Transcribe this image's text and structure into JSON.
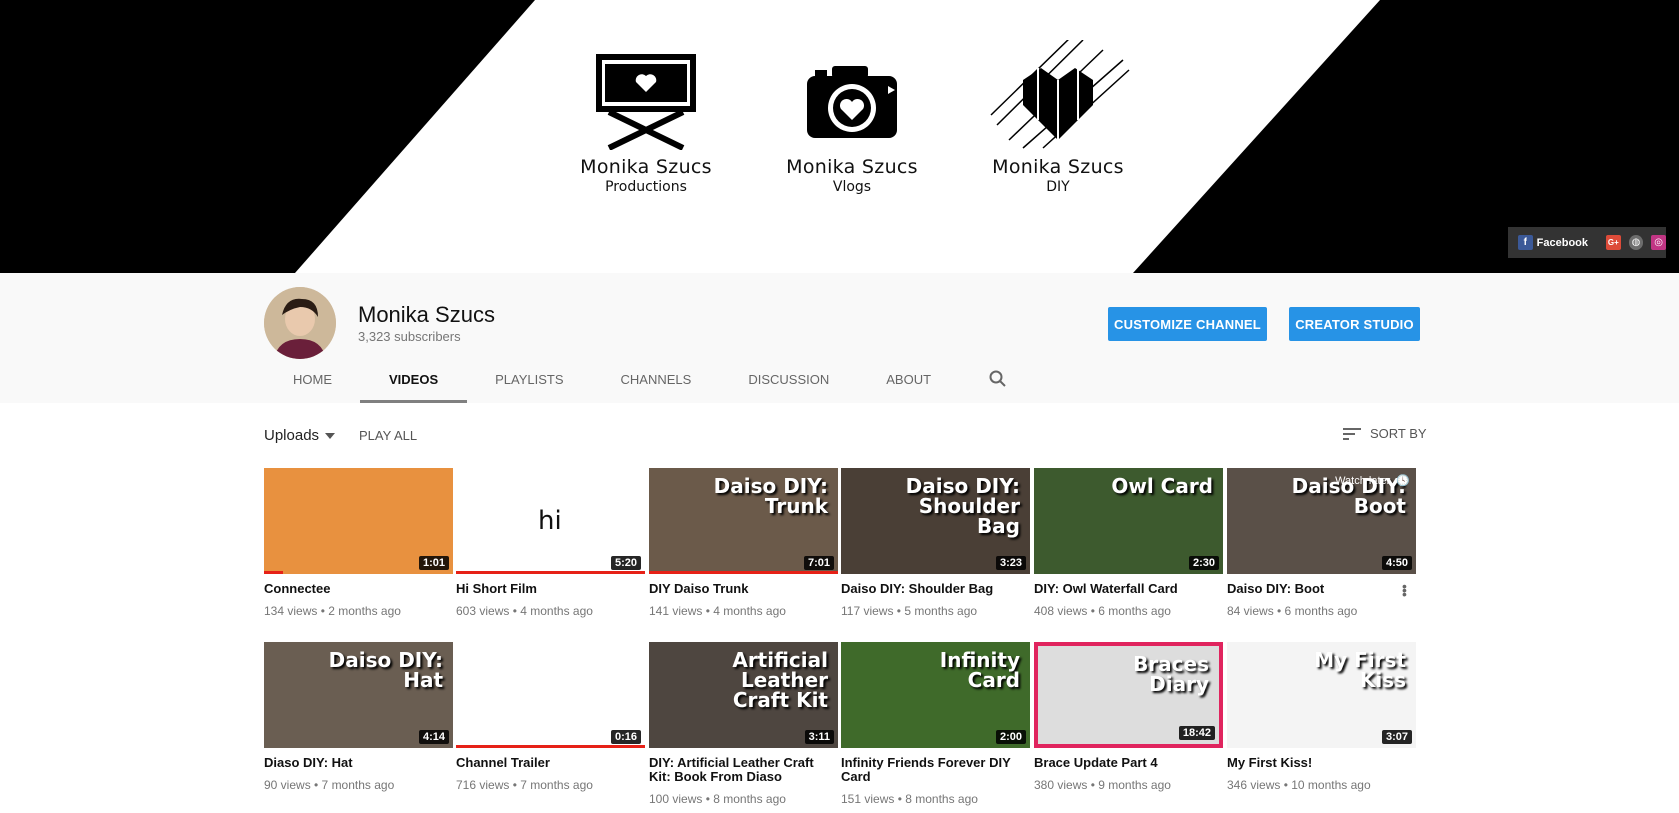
{
  "banner": {
    "brands": [
      {
        "name": "Monika Szucs",
        "sub": "Productions",
        "icon": "directors-chair-heart-icon"
      },
      {
        "name": "Monika Szucs",
        "sub": "Vlogs",
        "icon": "camera-heart-icon"
      },
      {
        "name": "Monika Szucs",
        "sub": "DIY",
        "icon": "striped-heart-icon"
      }
    ],
    "social": {
      "facebook_label": "Facebook",
      "icons": [
        "facebook-icon",
        "google-plus-icon",
        "website-icon",
        "instagram-icon"
      ]
    }
  },
  "channel": {
    "name": "Monika Szucs",
    "subscribers": "3,323 subscribers",
    "customize_label": "CUSTOMIZE CHANNEL",
    "studio_label": "CREATOR STUDIO"
  },
  "tabs": [
    "HOME",
    "VIDEOS",
    "PLAYLISTS",
    "CHANNELS",
    "DISCUSSION",
    "ABOUT"
  ],
  "active_tab": "VIDEOS",
  "toolbar": {
    "uploads_label": "Uploads",
    "play_all": "PLAY ALL",
    "sort_by": "SORT BY"
  },
  "watch_later": "Watch later",
  "videos": [
    {
      "title": "Connectee",
      "meta": "134 views • 2 months ago",
      "duration": "1:01",
      "thumb_text": "",
      "bg": "#e8913f",
      "progress": 0.1
    },
    {
      "title": "Hi Short Film",
      "meta": "603 views • 4 months ago",
      "duration": "5:20",
      "thumb_text": "hi",
      "bg": "#ffffff",
      "progress": 1.0
    },
    {
      "title": "DIY Daiso Trunk",
      "meta": "141 views • 4 months ago",
      "duration": "7:01",
      "thumb_text": "Daiso DIY: Trunk",
      "bg": "#6b5a4a",
      "progress": 1.0
    },
    {
      "title": "Daiso DIY: Shoulder Bag",
      "meta": "117 views • 5 months ago",
      "duration": "3:23",
      "thumb_text": "Daiso DIY: Shoulder Bag",
      "bg": "#4a3f36",
      "progress": 0
    },
    {
      "title": "DIY: Owl Waterfall Card",
      "meta": "408 views • 6 months ago",
      "duration": "2:30",
      "thumb_text": "Owl Card",
      "bg": "#3d5a2e",
      "progress": 0
    },
    {
      "title": "Daiso DIY: Boot",
      "meta": "84 views • 6 months ago",
      "duration": "4:50",
      "thumb_text": "Daiso DIY: Boot",
      "bg": "#5a5048",
      "progress": 0
    },
    {
      "title": "Diaso DIY: Hat",
      "meta": "90 views • 7 months ago",
      "duration": "4:14",
      "thumb_text": "Daiso DIY: Hat",
      "bg": "#6a5e52",
      "progress": 0
    },
    {
      "title": "Channel Trailer",
      "meta": "716 views • 7 months ago",
      "duration": "0:16",
      "thumb_text": "",
      "bg": "#ffffff",
      "progress": 1.0
    },
    {
      "title": "DIY: Artificial Leather Craft Kit: Book From Diaso",
      "meta": "100 views • 8 months ago",
      "duration": "3:11",
      "thumb_text": "Artificial Leather Craft Kit",
      "bg": "#4e4640",
      "progress": 0
    },
    {
      "title": "Infinity Friends Forever DIY Card",
      "meta": "151 views • 8 months ago",
      "duration": "2:00",
      "thumb_text": "Infinity Card",
      "bg": "#3f6a2a",
      "progress": 0
    },
    {
      "title": "Brace Update Part 4",
      "meta": "380 views • 9 months ago",
      "duration": "18:42",
      "thumb_text": "Braces Diary",
      "bg": "#e0245e",
      "progress": 0
    },
    {
      "title": "My First Kiss!",
      "meta": "346 views • 10 months ago",
      "duration": "3:07",
      "thumb_text": "My First Kiss",
      "bg": "#f4f4f4",
      "progress": 0
    }
  ]
}
